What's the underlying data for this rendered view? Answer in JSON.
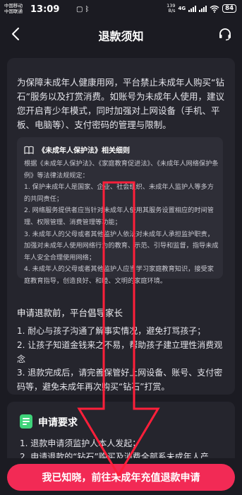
{
  "status_bar": {
    "carrier_1": "中国移动",
    "carrier_2": "中国联通",
    "time": "13:09",
    "net_speed_value": "139",
    "net_speed_unit": "B/s",
    "signal_label": "4G",
    "battery": "84"
  },
  "nav": {
    "title": "退款须知",
    "back_icon": "chevron-left-icon",
    "service_icon": "headset-icon"
  },
  "notice": {
    "paragraph": "为保障未成年人健康用网，平台禁止未成年人购买“钻石”服务以及打赏消费。如账号为未成年人使用，建议您开启青少年模式，同时加强对上网设备（手机、平板、电脑等）、支付密码的管理与限制。",
    "law": {
      "heading": "《未成年人保护法》相关细则",
      "lines": [
        "根据《未成年人保护法》、《家庭教育促进法》、《未成年人网络保护条例》等法律法规规定：",
        "1. 保护未成年人是国家、企业、社会组织、未成年人监护人等多方的共同责任；",
        "2. 网络服务提供者应当针对未成年人使用其服务设置相应的时间管理、权限管理、消费管理等功能；",
        "3. 未成年人的父母或者其他监护人依法对未成年人承担监护职责，加强对未成年人使用网络行为的教育、示范、引导和监督，指导未成年人安全合理使用网络；",
        "4. 未成年人的父母或者其他监护人应当学习家庭教育知识，接受家庭教育指导，创造良好、和睦、文明的家庭环境。"
      ]
    },
    "section_title": "申请退款前，平台倡导家长",
    "section_items": [
      "1. 耐心与孩子沟通了解事实情况，避免打骂孩子；",
      "2. 让孩子知道金钱来之不易，帮助孩子建立理性消费观念",
      "3. 退款完成后，请完善保管好上网设备、账号、支付密码等，避免未成年再次购买“钻石”打赏。"
    ]
  },
  "requirements": {
    "title": "申请要求",
    "icon": "document-icon",
    "items": [
      "1. 退款申请须监护人本人发起；",
      "2. 申请退款的“钻石”购买及消费全部系未成年人产"
    ]
  },
  "cta": {
    "label": "我已知晓，前往未成年充值退款申请",
    "color": "#f22a55"
  },
  "annotation": {
    "arrow_color": "#ff1f3a"
  }
}
